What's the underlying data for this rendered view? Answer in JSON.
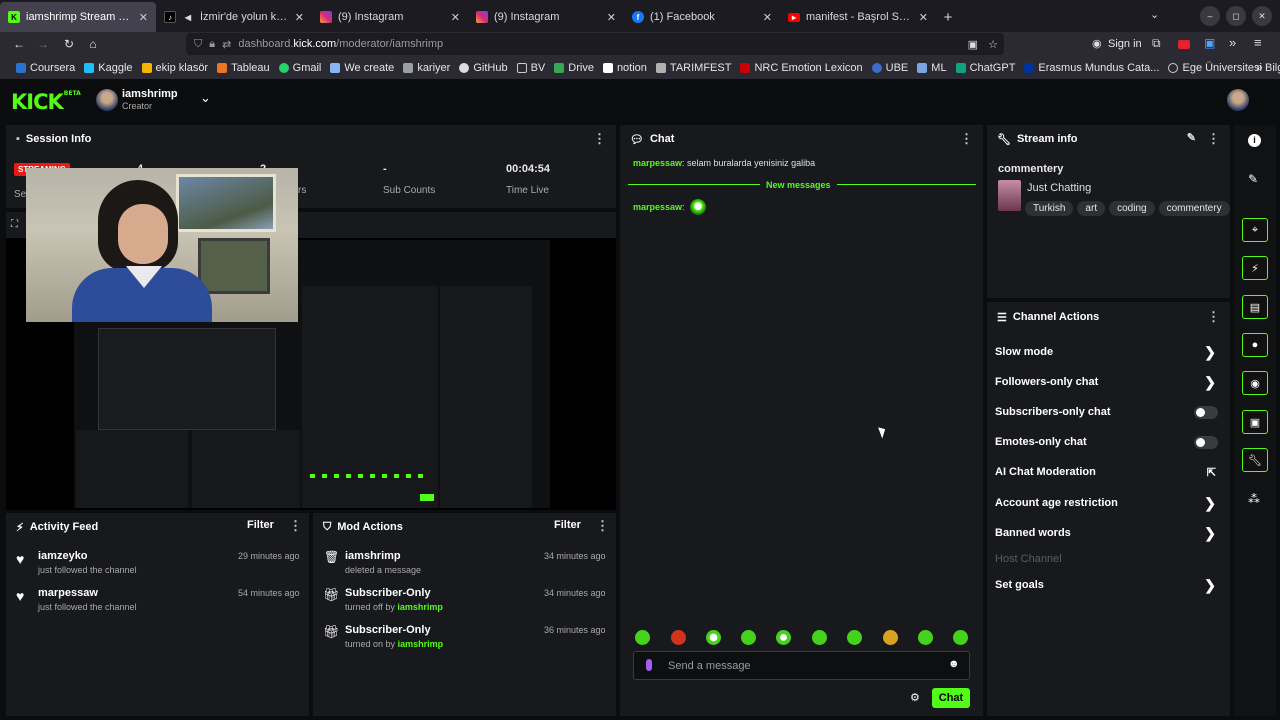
{
  "browser": {
    "tabs": [
      {
        "title": "iamshrimp Stream - Kick D",
        "icon": "kick-icon",
        "active": true
      },
      {
        "title": "İzmir'de yolun karşısın",
        "icon": "tiktok-icon"
      },
      {
        "title": "(9) Instagram",
        "icon": "instagram-icon"
      },
      {
        "title": "(9) Instagram",
        "icon": "instagram-icon"
      },
      {
        "title": "(1) Facebook",
        "icon": "facebook-icon"
      },
      {
        "title": "manifest - Başrol Sensin |",
        "icon": "youtube-icon"
      }
    ],
    "url_prefix": "dashboard.",
    "url_domain": "kick.com",
    "url_path": "/moderator/iamshrimp",
    "sign_in": "Sign in",
    "bookmarks": [
      "Coursera",
      "Kaggle",
      "ekip klasör",
      "Tableau",
      "Gmail",
      "We create",
      "kariyer",
      "GitHub",
      "BV",
      "Drive",
      "notion",
      "TARIMFEST",
      "NRC Emotion Lexicon",
      "UBE",
      "ML",
      "ChatGPT",
      "Erasmus Mundus Cata...",
      "Ege Üniversitesi Bilgi ..."
    ]
  },
  "header": {
    "logo": "KICK",
    "logo_badge": "BETA",
    "channel_name": "iamshrimp",
    "channel_role": "Creator"
  },
  "session_info": {
    "title": "Session Info",
    "live_badge": "STREAMING",
    "viewers": "4",
    "followers": "2",
    "followers_label_tail": "rs",
    "sub_counts": "-",
    "sub_counts_label": "Sub Counts",
    "time_live": "00:04:54",
    "time_live_label": "Time Live",
    "se_label": "Se"
  },
  "activity_feed": {
    "title": "Activity Feed",
    "filter": "Filter",
    "items": [
      {
        "name": "iamzeyko",
        "text": "just followed the channel",
        "time": "29 minutes ago"
      },
      {
        "name": "marpessaw",
        "text": "just followed the channel",
        "time": "54 minutes ago"
      }
    ]
  },
  "mod_actions": {
    "title": "Mod Actions",
    "filter": "Filter",
    "items": [
      {
        "name": "iamshrimp",
        "text": "deleted a message",
        "by": "",
        "time": "34 minutes ago"
      },
      {
        "name": "Subscriber-Only",
        "text": "turned off by",
        "by": "iamshrimp",
        "time": "34 minutes ago"
      },
      {
        "name": "Subscriber-Only",
        "text": "turned on by",
        "by": "iamshrimp",
        "time": "36 minutes ago"
      }
    ]
  },
  "chat": {
    "title": "Chat",
    "messages": [
      {
        "user": "marpessaw",
        "text": ": selam buralarda yenisiniz galiba"
      }
    ],
    "divider": "New messages",
    "new_messages": [
      {
        "user": "marpessaw",
        "text": ":"
      }
    ],
    "input_placeholder": "Send a message",
    "send_button": "Chat"
  },
  "stream_info": {
    "title": "Stream info",
    "stream_title": "commentery",
    "category": "Just Chatting",
    "tags": [
      "Turkish",
      "art",
      "coding",
      "commentery"
    ]
  },
  "channel_actions": {
    "title": "Channel Actions",
    "items": [
      {
        "label": "Slow mode",
        "type": "chevron"
      },
      {
        "label": "Followers-only chat",
        "type": "chevron"
      },
      {
        "label": "Subscribers-only chat",
        "type": "toggle"
      },
      {
        "label": "Emotes-only chat",
        "type": "toggle"
      },
      {
        "label": "AI Chat Moderation",
        "type": "external"
      },
      {
        "label": "Account age restriction",
        "type": "chevron"
      },
      {
        "label": "Banned words",
        "type": "chevron"
      },
      {
        "label": "Host Channel",
        "type": "disabled"
      },
      {
        "label": "Set goals",
        "type": "chevron"
      }
    ]
  },
  "colors": {
    "accent": "#53fc18",
    "panel": "#18191d",
    "background": "#0b0c0e"
  }
}
